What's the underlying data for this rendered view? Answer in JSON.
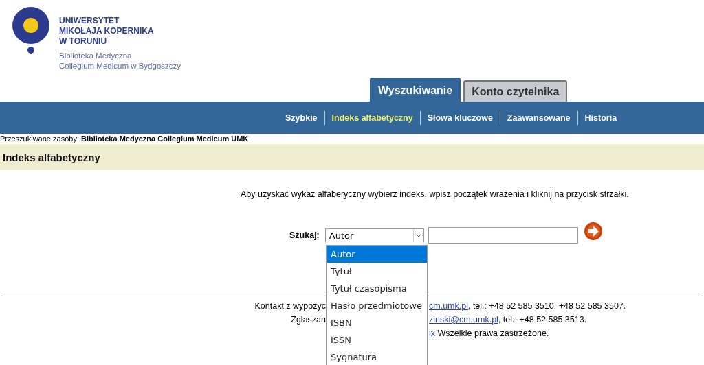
{
  "logo": {
    "university": [
      "UNIWERSYTET",
      "MIKOŁAJA KOPERNIKA",
      "W TORUNIU"
    ],
    "library": [
      "Biblioteka Medyczna",
      "Collegium Medicum w Bydgoszczy"
    ]
  },
  "tabs": [
    {
      "label": "Wyszukiwanie",
      "selected": true
    },
    {
      "label": "Konto czytelnika",
      "selected": false
    }
  ],
  "subnav": [
    {
      "label": "Szybkie",
      "selected": false
    },
    {
      "label": "Indeks alfabetyczny",
      "selected": true
    },
    {
      "label": "Słowa kluczowe",
      "selected": false
    },
    {
      "label": "Zaawansowane",
      "selected": false
    },
    {
      "label": "Historia",
      "selected": false
    }
  ],
  "resources": {
    "label": "Przeszukiwane zasoby:",
    "value": "Biblioteka Medyczna Collegium Medicum UMK"
  },
  "section_title": "Indeks alfabetyczny",
  "instructions": "Aby uzyskać wykaz alfaberyczny wybierz indeks, wpisz początek wrażenia i kliknij na przycisk strzałki.",
  "search": {
    "label": "Szukaj:",
    "select_value": "Autor",
    "options": [
      {
        "label": "Autor",
        "selected": true
      },
      {
        "label": "Tytuł",
        "selected": false
      },
      {
        "label": "Tytuł czasopisma",
        "selected": false
      },
      {
        "label": "Hasło przedmiotowe",
        "selected": false
      },
      {
        "label": "ISBN",
        "selected": false
      },
      {
        "label": "ISSN",
        "selected": false
      },
      {
        "label": "Sygnatura",
        "selected": false
      }
    ]
  },
  "footer": [
    {
      "left": "Kontakt z wypożyc",
      "link": "cm.umk.pl",
      "right": ", tel.: +48 52 585 3510, +48 52 585 3507."
    },
    {
      "left": "Zgłaszan",
      "link": "zinski@cm.umk.pl",
      "right": ", tel.: +48 52 585 3513."
    },
    {
      "link": "ix",
      "right": " Wszelkie prawa zastrzeżone."
    }
  ]
}
